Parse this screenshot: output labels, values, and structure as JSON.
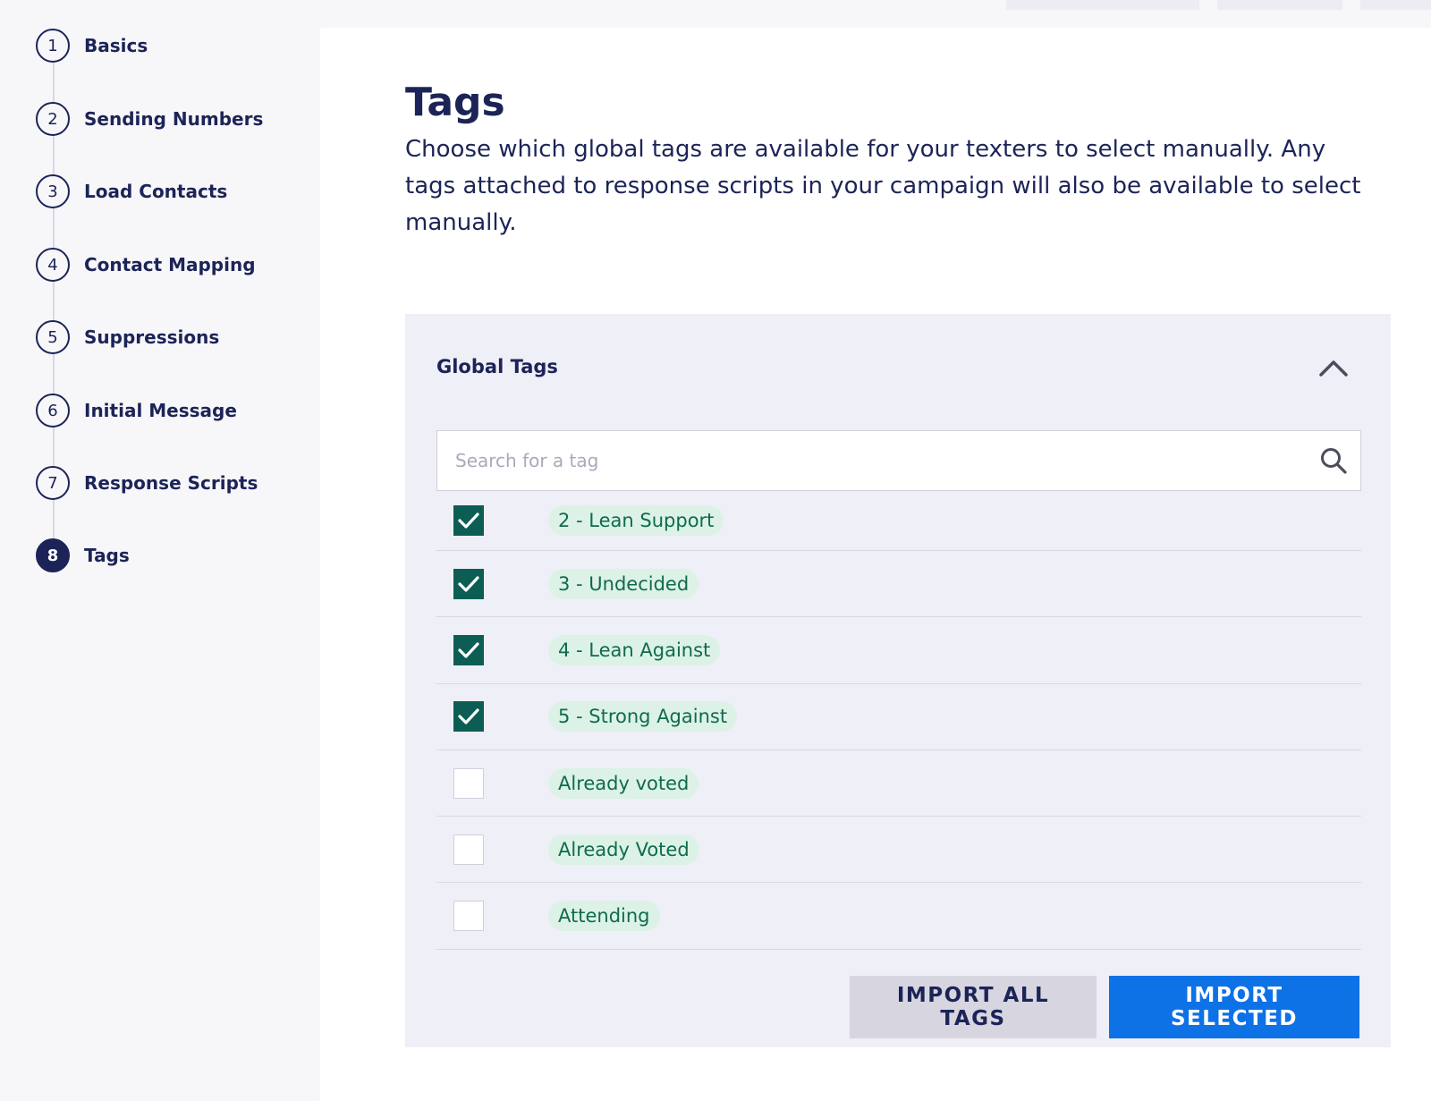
{
  "sidebar": {
    "steps": [
      {
        "number": "1",
        "label": "Basics"
      },
      {
        "number": "2",
        "label": "Sending Numbers"
      },
      {
        "number": "3",
        "label": "Load Contacts"
      },
      {
        "number": "4",
        "label": "Contact Mapping"
      },
      {
        "number": "5",
        "label": "Suppressions"
      },
      {
        "number": "6",
        "label": "Initial Message"
      },
      {
        "number": "7",
        "label": "Response Scripts"
      },
      {
        "number": "8",
        "label": "Tags"
      }
    ],
    "active_step": "8"
  },
  "main": {
    "title": "Tags",
    "description": "Choose which global tags are available for your texters to select manually. Any tags attached to response scripts in your campaign will also be available to select manually."
  },
  "panel": {
    "title": "Global Tags",
    "toggle_icon": "chevron-up-icon",
    "search": {
      "placeholder": "Search for a tag",
      "value": "",
      "icon": "search-icon"
    },
    "tags": [
      {
        "label": "2 - Lean Support",
        "checked": true
      },
      {
        "label": "3 - Undecided",
        "checked": true
      },
      {
        "label": "4 - Lean Against",
        "checked": true
      },
      {
        "label": "5 - Strong Against",
        "checked": true
      },
      {
        "label": "Already voted",
        "checked": false
      },
      {
        "label": "Already Voted",
        "checked": false
      },
      {
        "label": "Attending",
        "checked": false
      }
    ],
    "import_all_label": "IMPORT ALL TAGS",
    "import_selected_label": "IMPORT SELECTED"
  },
  "colors": {
    "navy": "#1c2457",
    "checkbox_checked": "#0c5e54",
    "tag_bg": "#dcf2e6",
    "tag_text": "#0f6b4e",
    "primary_button": "#0d72e6",
    "secondary_button": "#d7d6e0"
  }
}
